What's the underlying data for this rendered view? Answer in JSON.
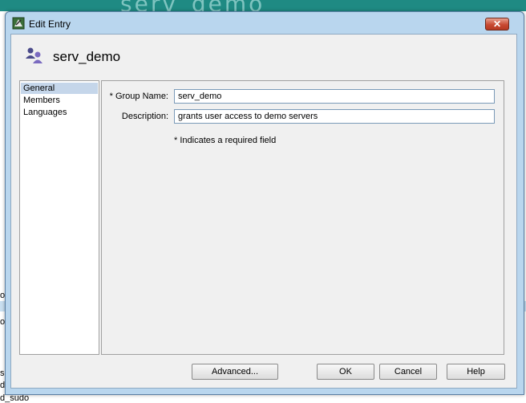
{
  "background": {
    "top_text": "serv_demo",
    "left_fragments": [
      "o",
      "o",
      "s",
      "d",
      "d_sudo"
    ]
  },
  "window": {
    "title": "Edit Entry",
    "close_glyph": "✕"
  },
  "header": {
    "title": "serv_demo",
    "icon": "group-icon"
  },
  "nav": {
    "items": [
      {
        "label": "General",
        "selected": true
      },
      {
        "label": "Members",
        "selected": false
      },
      {
        "label": "Languages",
        "selected": false
      }
    ]
  },
  "form": {
    "group_name_label": "* Group Name:",
    "group_name_value": "serv_demo",
    "description_label": "Description:",
    "description_value": "grants user access to demo servers",
    "required_note": "* Indicates a required field"
  },
  "buttons": {
    "advanced": "Advanced...",
    "ok": "OK",
    "cancel": "Cancel",
    "help": "Help"
  },
  "colors": {
    "title_bar": "#b9d6ee",
    "selected_nav": "#c5d6ea",
    "close_button": "#c84a32"
  }
}
